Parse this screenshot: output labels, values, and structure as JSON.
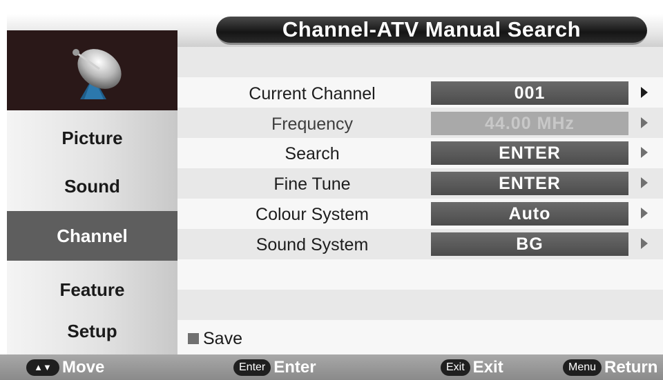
{
  "header": {
    "title": "Channel-ATV Manual Search"
  },
  "sidebar": {
    "icon": "satellite-dish-icon",
    "items": [
      {
        "label": "Picture",
        "active": false
      },
      {
        "label": "Sound",
        "active": false
      },
      {
        "label": "Channel",
        "active": true
      },
      {
        "label": "Feature",
        "active": false
      },
      {
        "label": "Setup",
        "active": false
      }
    ]
  },
  "settings": [
    {
      "label": "Current Channel",
      "value": "001",
      "enabled": true
    },
    {
      "label": "Frequency",
      "value": "44.00 MHz",
      "enabled": false
    },
    {
      "label": "Search",
      "value": "ENTER",
      "enabled": true
    },
    {
      "label": "Fine Tune",
      "value": "ENTER",
      "enabled": true
    },
    {
      "label": "Colour System",
      "value": "Auto",
      "enabled": true
    },
    {
      "label": "Sound System",
      "value": "BG",
      "enabled": true
    }
  ],
  "save": {
    "label": "Save"
  },
  "hints": [
    {
      "key": "▲▼",
      "label": "Move"
    },
    {
      "key": "Enter",
      "label": "Enter"
    },
    {
      "key": "Exit",
      "label": "Exit"
    },
    {
      "key": "Menu",
      "label": "Return"
    }
  ],
  "colors": {
    "title_bar": "#151515",
    "active_item": "#5e5e5e",
    "value_box": "#4c4c4c",
    "disabled_value": "#a9a9a9",
    "hint_bar": "#8a8a8a"
  }
}
